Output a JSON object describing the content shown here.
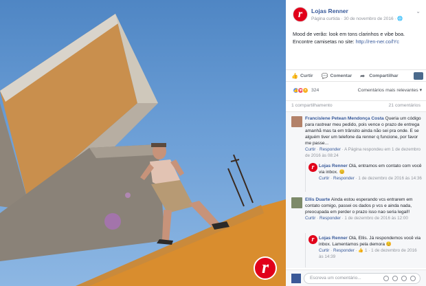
{
  "photo": {
    "alt_logo": "r"
  },
  "post": {
    "page_name": "Lojas Renner",
    "meta": "Página curtida · 30 de novembro de 2016 · 🌐",
    "message_line1": "Mood de verão: look em tons clarinhos e vibe boa.",
    "message_line2_prefix": "Encontre camisetas no site: ",
    "message_link": "http://ren-ner.co/lYc",
    "logo_letter": "r"
  },
  "actions": {
    "like": "Curtir",
    "comment": "Comentar",
    "share": "Compartilhar"
  },
  "reactions": {
    "count": "324",
    "sort": "Comentários mais relevantes ▾"
  },
  "stats": {
    "shares": "1 compartilhamento",
    "comments": "21 comentários"
  },
  "comments": [
    {
      "name": "Francislene Petean Mendonça Costa",
      "text": "Queria um código para rastrear meu pedido, pois vence o prazo de entrega amanhã mas ta em trânsito ainda não sei pra onde. E se alguém tiver um telefone da renner q funcione, por favor me passe...",
      "actions_like": "Curtir",
      "actions_reply": "Responder",
      "actions_meta": " · A Página respondeu em 1 de dezembro de 2016 às 08:24",
      "reply": {
        "name": "Lojas Renner",
        "text": "Olá, entramos em contato com você via inbox. 😊",
        "like": "Curtir",
        "reply": "Responder",
        "meta": " · 1 de dezembro de 2016 às 14:36"
      }
    },
    {
      "name": "Ellis Duarte",
      "text": "Ainda estou esperando vcs entrarem em contato comigo, passei os dados p vcs e ainda nada, preocupada em perder o prazo isso nao seria legal!!",
      "actions_like": "Curtir",
      "actions_reply": "Responder",
      "actions_meta": " · 1 de dezembro de 2016 às 12:00",
      "reply": {
        "name": "Lojas Renner",
        "text": "Olá, Ellis. Já respondemos você via inbox. Lamentamos pela demora 😊",
        "like": "Curtir",
        "reply": "Responder",
        "meta": " · 👍 1 · 1 de dezembro de 2016 às 14:39"
      }
    }
  ],
  "composer": {
    "placeholder": "Escreva um comentário..."
  }
}
